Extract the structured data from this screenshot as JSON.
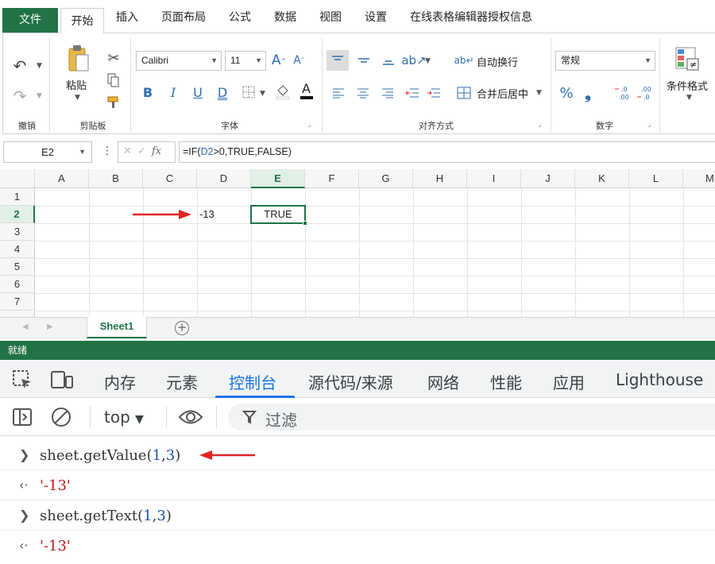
{
  "ribbon": {
    "tabs": [
      "文件",
      "开始",
      "插入",
      "页面布局",
      "公式",
      "数据",
      "视图",
      "设置",
      "在线表格编辑器授权信息"
    ],
    "active_tab": "开始",
    "groups": {
      "undo": {
        "label": "撤销"
      },
      "clipboard": {
        "label": "剪贴板",
        "paste_label": "粘贴"
      },
      "font": {
        "label": "字体",
        "font_name": "Calibri",
        "font_size": "11",
        "bold": "B",
        "italic": "I",
        "underline": "U",
        "double_underline": "D"
      },
      "alignment": {
        "label": "对齐方式",
        "wrap_text": "自动换行",
        "merge_center": "合并后居中"
      },
      "number": {
        "label": "数字",
        "format": "常规",
        "percent": "%",
        "comma": "❟"
      },
      "styles": {
        "cond_format": "条件格式"
      }
    },
    "accent": "#217346"
  },
  "formula_bar": {
    "name_box": "E2",
    "fx": "fx",
    "formula_prefix": "=IF(",
    "formula_ref": "D2",
    "formula_suffix": ">0,TRUE,FALSE)"
  },
  "sheet": {
    "columns": [
      "A",
      "B",
      "C",
      "D",
      "E",
      "F",
      "G",
      "H",
      "I",
      "J",
      "K",
      "L",
      "M"
    ],
    "selected_column": "E",
    "rows": [
      "1",
      "2",
      "3",
      "4",
      "5",
      "6",
      "7"
    ],
    "selected_row": "2",
    "cells": {
      "D2": "-13",
      "E2": "TRUE"
    },
    "active_cell": "E2"
  },
  "sheet_tabs": {
    "tabs": [
      "Sheet1"
    ],
    "active": "Sheet1",
    "add": "+"
  },
  "status_bar": {
    "text": "就绪"
  },
  "devtools": {
    "tabs": [
      "内存",
      "元素",
      "控制台",
      "源代码/来源",
      "网络",
      "性能",
      "应用",
      "Lighthouse"
    ],
    "active_tab": "控制台",
    "context": "top",
    "filter_placeholder": "过滤",
    "console": [
      {
        "type": "input",
        "fn": "sheet.getValue(",
        "arg1": "1",
        "sep": ",",
        "arg2": "3",
        "close": ")"
      },
      {
        "type": "output",
        "value": "'-13'"
      },
      {
        "type": "input",
        "fn": "sheet.getText(",
        "arg1": "1",
        "sep": ",",
        "arg2": "3",
        "close": ")"
      },
      {
        "type": "output",
        "value": "'-13'"
      }
    ]
  },
  "colors": {
    "excel_green": "#217346",
    "devtools_blue": "#1a73e8",
    "annotation_red": "#e02424",
    "string_red": "#c41a16"
  }
}
